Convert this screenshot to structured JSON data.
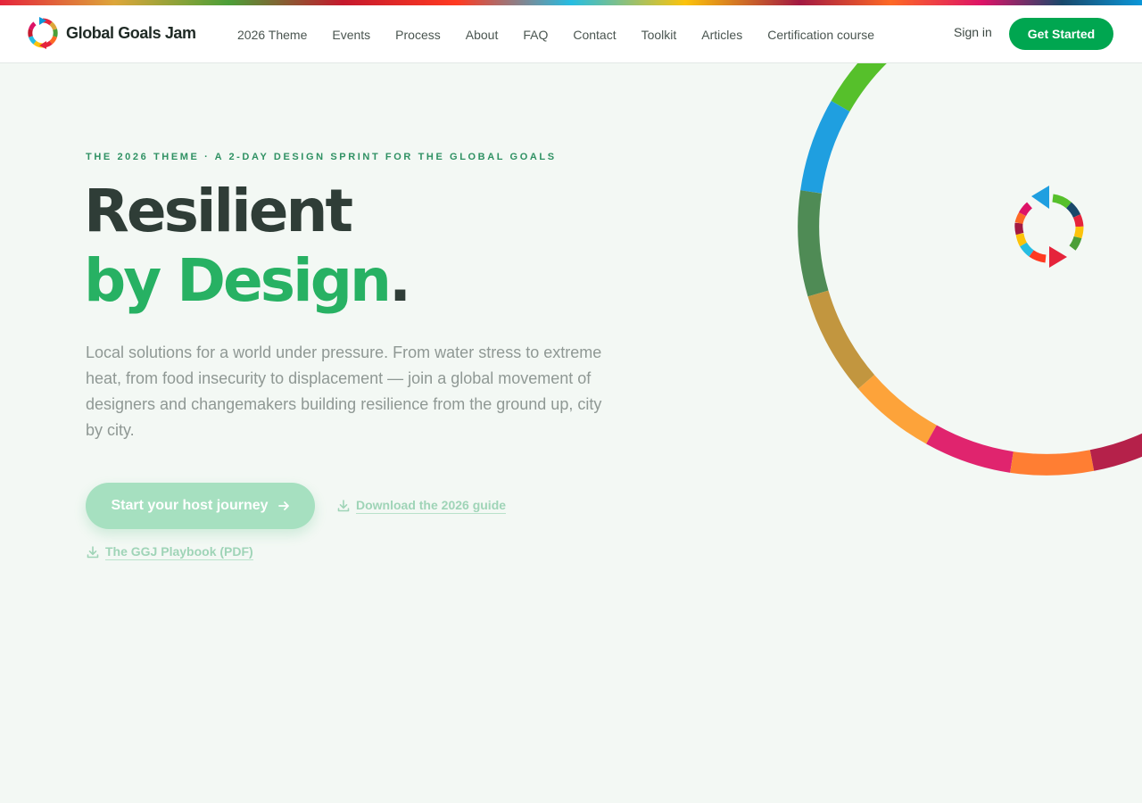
{
  "brand": {
    "name": "Global Goals Jam"
  },
  "nav": {
    "items": [
      {
        "label": "2026 Theme"
      },
      {
        "label": "Events"
      },
      {
        "label": "Process"
      },
      {
        "label": "About"
      },
      {
        "label": "FAQ"
      },
      {
        "label": "Contact"
      },
      {
        "label": "Toolkit"
      },
      {
        "label": "Articles"
      },
      {
        "label": "Certification course"
      }
    ],
    "signin_label": "Sign in",
    "cta_label": "Get Started"
  },
  "hero": {
    "eyebrow": "THE 2026 THEME · A 2-DAY DESIGN SPRINT FOR THE GLOBAL GOALS",
    "title_line1": "Resilient",
    "title_line2": "by Design",
    "title_dot": ".",
    "lead": "Local solutions for a world under pressure. From water stress to extreme heat, from food insecurity to displacement — join a global movement of designers and changemakers building resilience from the ground up, city by city.",
    "primary_button": "Start your host journey",
    "guide_link": "Download the 2026 guide",
    "playbook_link": "The GGJ Playbook (PDF)"
  },
  "icons": {
    "logo": "sdg-circular-arrows-logo",
    "arrow": "arrow-right-icon",
    "download": "download-icon"
  },
  "colors": {
    "accent": "#00a650",
    "heading_dark": "#2f3d37",
    "heading_green": "#27b163",
    "page_bg": "#f3f8f4"
  }
}
